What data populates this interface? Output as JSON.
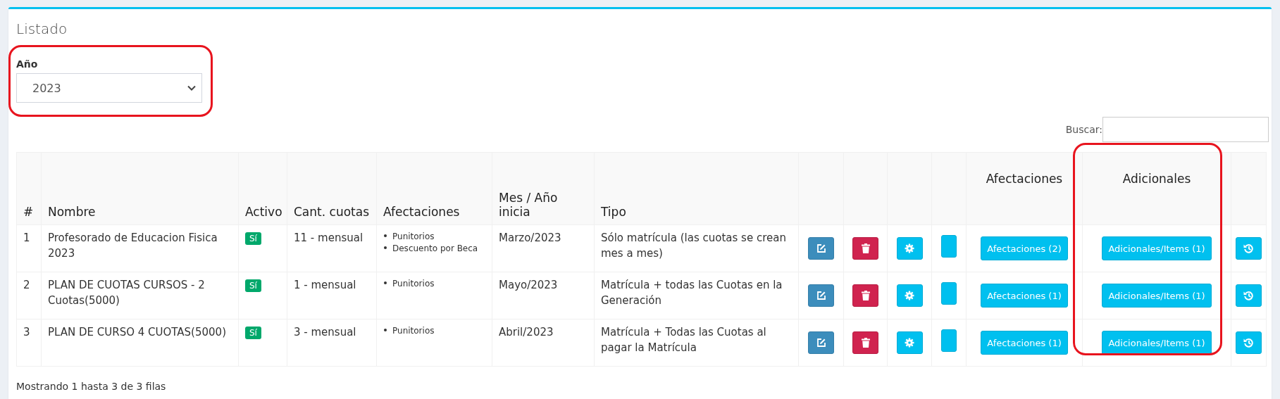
{
  "card": {
    "title": "Listado"
  },
  "year_filter": {
    "label": "Año",
    "value": "2023"
  },
  "search": {
    "label": "Buscar:"
  },
  "table": {
    "columns": [
      "#",
      "Nombre",
      "Activo",
      "Cant. cuotas",
      "Afectaciones",
      "Mes / Año inicia",
      "Tipo"
    ],
    "action_columns": [
      "Afectaciones",
      "Adicionales"
    ],
    "rows": [
      {
        "number": "1",
        "name": "Profesorado de Educacion Fisica 2023",
        "active": "Sí",
        "installments": "11 - mensual",
        "affectations": [
          "Punitorios",
          "Descuento por Beca"
        ],
        "start": "Marzo/2023",
        "type": "Sólo matrícula (las cuotas se crean mes a mes)",
        "affectations_button": "Afectaciones (2)",
        "additionals_button": "Adicionales/Items (1)"
      },
      {
        "number": "2",
        "name": "PLAN DE CUOTAS CURSOS - 2 Cuotas(5000)",
        "active": "Sí",
        "installments": "1 - mensual",
        "affectations": [
          "Punitorios"
        ],
        "start": "Mayo/2023",
        "type": "Matrícula + todas las Cuotas en la Generación",
        "affectations_button": "Afectaciones (1)",
        "additionals_button": "Adicionales/Items (1)"
      },
      {
        "number": "3",
        "name": "PLAN DE CURSO 4 CUOTAS(5000)",
        "active": "Sí",
        "installments": "3 - mensual",
        "affectations": [
          "Punitorios"
        ],
        "start": "Abril/2023",
        "type": "Matrícula + Todas las Cuotas al pagar la Matrícula",
        "affectations_button": "Afectaciones (1)",
        "additionals_button": "Adicionales/Items (1)"
      }
    ]
  },
  "footer": "Mostrando 1 hasta 3 de 3 filas"
}
